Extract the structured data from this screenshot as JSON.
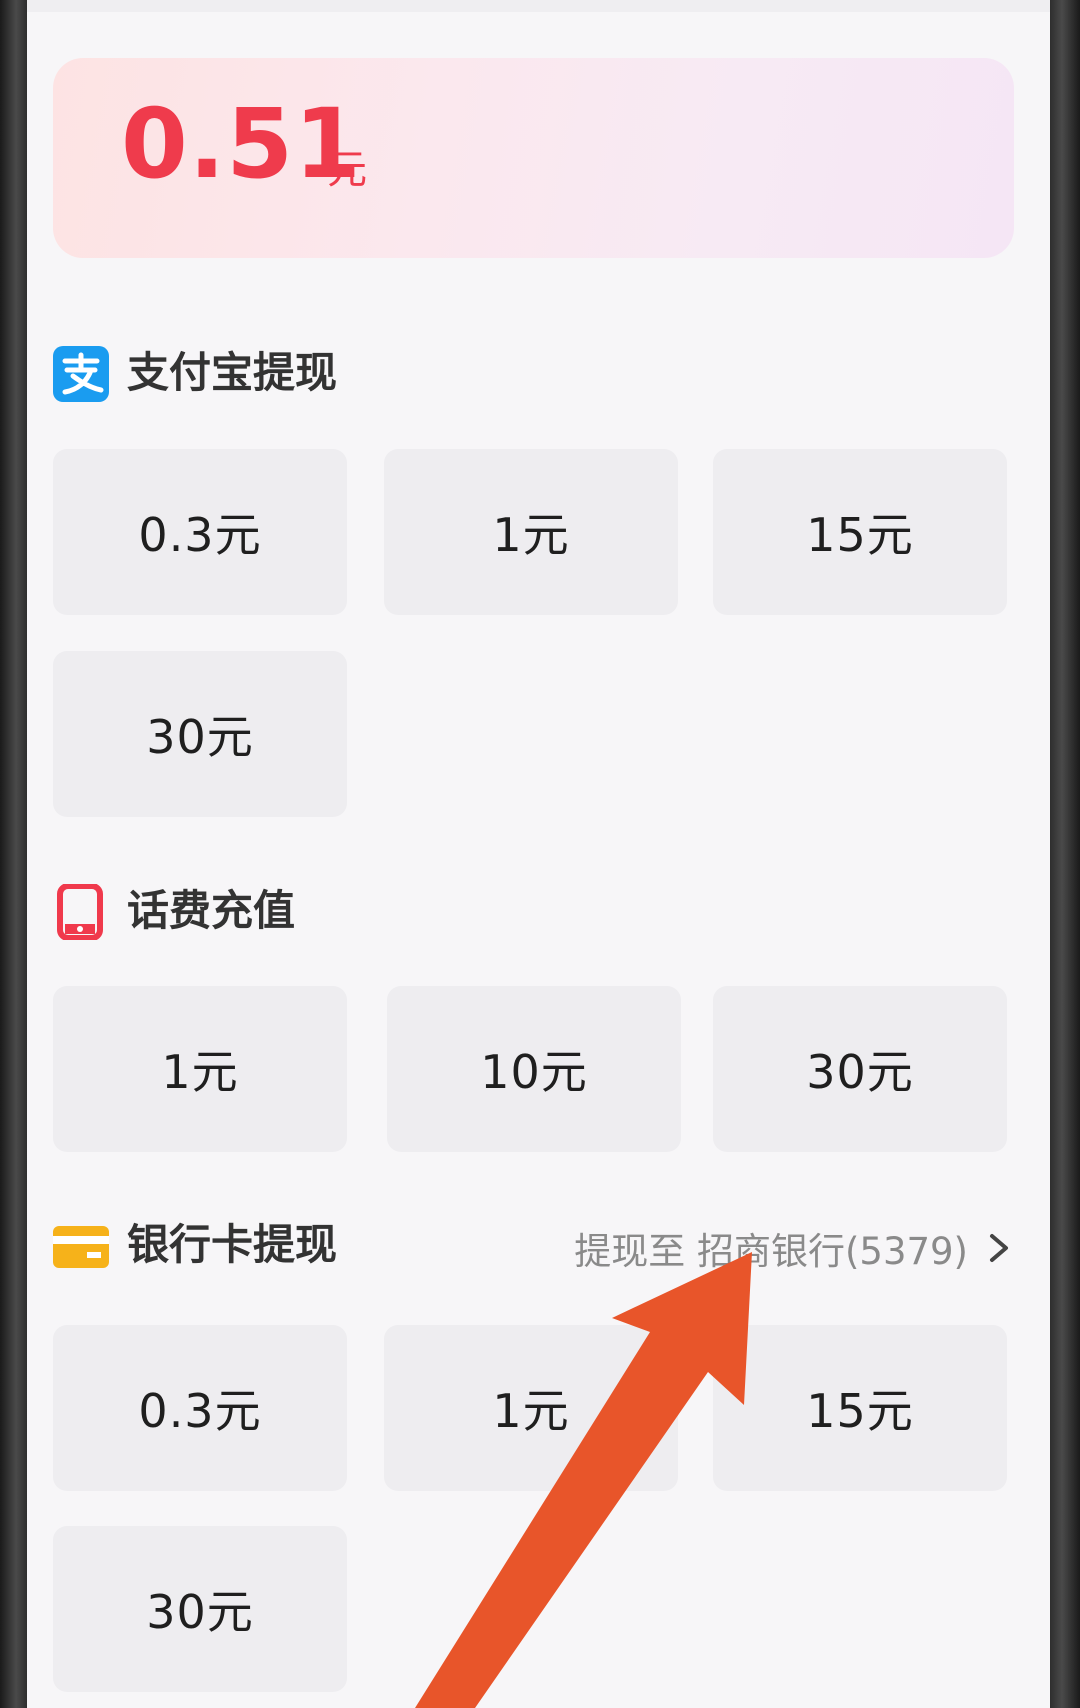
{
  "balance": {
    "amount": "0.51",
    "unit": "元"
  },
  "sections": {
    "alipay": {
      "title": "支付宝提现",
      "icon": "alipay-icon",
      "color": "#1a9cf0",
      "options": [
        "0.3元",
        "1元",
        "15元",
        "30元"
      ]
    },
    "phone": {
      "title": "话费充值",
      "icon": "phone-icon",
      "color": "#f0394c",
      "options": [
        "1元",
        "10元",
        "30元"
      ]
    },
    "bank": {
      "title": "银行卡提现",
      "icon": "bank-card-icon",
      "color": "#f6b21a",
      "link_text": "提现至 招商银行(5379)",
      "options": [
        "0.3元",
        "1元",
        "15元",
        "30元"
      ]
    }
  },
  "annotation": {
    "arrow_color": "#e8552a"
  },
  "colors": {
    "accent": "#ef3b4c",
    "background": "#f7f6f8",
    "tile": "#eeedf0"
  }
}
